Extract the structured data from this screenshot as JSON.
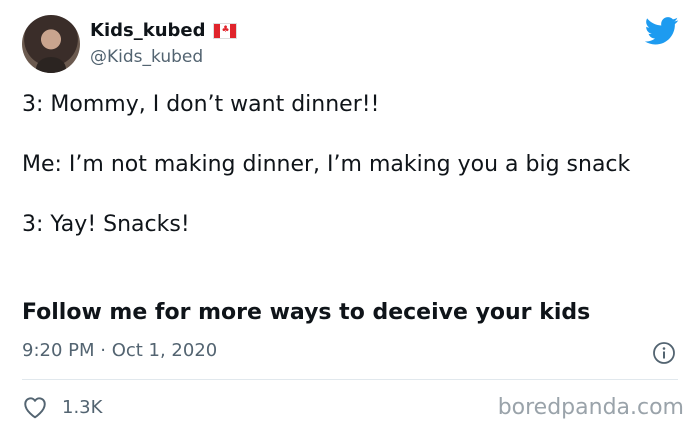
{
  "tweet": {
    "display_name": "Kids_kubed",
    "flag_icon": "canada-flag-icon",
    "handle": "@Kids_kubed",
    "lines": [
      "3: Mommy, I don’t want dinner!!",
      "Me: I’m not making dinner, I’m making you a big snack",
      "3: Yay! Snacks!"
    ],
    "bold_line": "Follow me for more ways to deceive your kids",
    "timestamp": "9:20 PM · Oct 1, 2020",
    "likes": "1.3K"
  },
  "branding": {
    "platform_icon": "twitter-bird-icon",
    "platform_color": "#1d9bf0",
    "watermark": "boredpanda.com"
  }
}
